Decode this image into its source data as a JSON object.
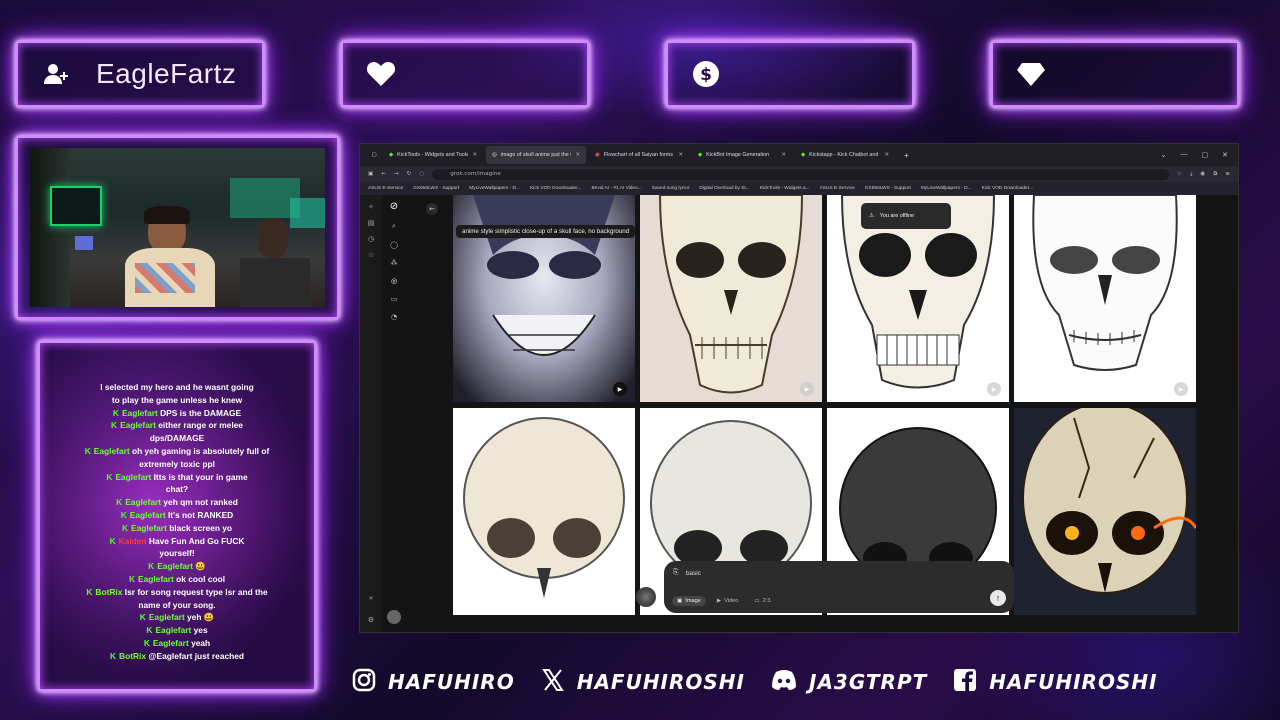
{
  "overlay": {
    "follower_name": "EagleFartz",
    "top_boxes": [
      {
        "icon": "user-plus-icon"
      },
      {
        "icon": "heart-icon"
      },
      {
        "icon": "dollar-icon"
      },
      {
        "icon": "diamond-icon"
      }
    ],
    "socials": [
      {
        "icon": "instagram-icon",
        "handle": "HAFUHIRO"
      },
      {
        "icon": "x-icon",
        "handle": "HAFUHIROSHI"
      },
      {
        "icon": "discord-icon",
        "handle": "JA3GTRPT"
      },
      {
        "icon": "facebook-icon",
        "handle": "HAFUHIROSHI"
      }
    ],
    "accent": "#b44cff"
  },
  "chat": [
    {
      "user": "",
      "text": "I selected my hero and he wasnt going"
    },
    {
      "user": "",
      "text": "to play the game unless he knew"
    },
    {
      "user": "Eaglefart",
      "text": "DPS is the DAMAGE"
    },
    {
      "user": "Eaglefart",
      "text": "either range or melee"
    },
    {
      "user": "",
      "text": "dps/DAMAGE"
    },
    {
      "user": "Eaglefart",
      "text": "oh yeh gaming is absolutely full of"
    },
    {
      "user": "",
      "text": "extremely toxic ppl"
    },
    {
      "user": "Eaglefart",
      "text": "Itts is that your in game"
    },
    {
      "user": "",
      "text": "chat?"
    },
    {
      "user": "Eaglefart",
      "text": "yeh qm not ranked"
    },
    {
      "user": "Eaglefart",
      "text": "It's not RANKED"
    },
    {
      "user": "Eaglefart",
      "text": "black screen yo"
    },
    {
      "user": "Kaiden",
      "text": "Have Fun And Go FUCK",
      "red": true
    },
    {
      "user": "",
      "text": "yourself!"
    },
    {
      "user": "Eaglefart",
      "text": "😃"
    },
    {
      "user": "Eaglefart",
      "text": "ok cool cool"
    },
    {
      "user": "BotRix",
      "text": "lsr for song request type lsr and the"
    },
    {
      "user": "",
      "text": "name of your song."
    },
    {
      "user": "Eaglefart",
      "text": "yeh 😃"
    },
    {
      "user": "Eaglefart",
      "text": "yes"
    },
    {
      "user": "Eaglefart",
      "text": "yeah"
    },
    {
      "user": "BotRix",
      "text": "@Eaglefart just reached"
    }
  ],
  "browser": {
    "tabs": [
      {
        "label": "KickTools - Widgets and Tools f",
        "active": false
      },
      {
        "label": "image of skull anime just the fa",
        "active": true
      },
      {
        "label": "Flowchart of all Saiyan forms (u",
        "active": false
      },
      {
        "label": "KickBot Image Generation",
        "active": false
      },
      {
        "label": "Kickstapp - Kick Chatbot and",
        "active": false
      }
    ],
    "url": "grok.com/imagine",
    "bookmarks": [
      "ASUS E-Service",
      "GX550LWS - Support",
      "MyLiveWallpapers - D...",
      "Kick VOD Downloader...",
      "Bevid AI - #1 AI Video...",
      "Saved song lyrics",
      "Digital Overload by St...",
      "KickTools - Widgets a...",
      "ASUS E-Service",
      "GX550LWS - Support",
      "MyLiveWallpapers - D...",
      "Kick VOD Downloader..."
    ],
    "tooltip": "anime style simplistic close-up of a skull face, no background",
    "offline_notice": "You are offline",
    "prompt_text": "basic",
    "prompt_options": [
      {
        "label": "Image",
        "selected": true
      },
      {
        "label": "Video",
        "selected": false
      },
      {
        "label": "2:3",
        "selected": false
      }
    ]
  }
}
